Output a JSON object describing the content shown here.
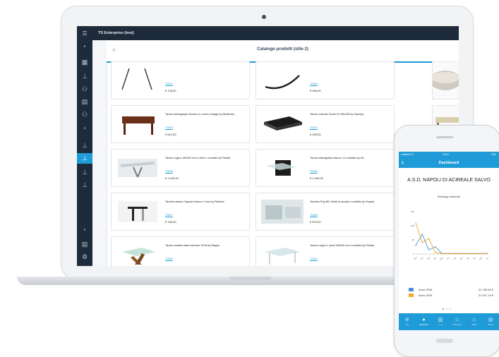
{
  "laptop": {
    "app_title": "TS Enterprise (test)",
    "page_title": "Catalogo prodotti (stile 2)",
    "products": [
      {
        "name": "",
        "link": "T0001",
        "price": "€ 178,00"
      },
      {
        "name": "",
        "link": "T0002",
        "price": "€ 265,00"
      },
      {
        "name": "Tavolo rettangolare Moreno in rovere vintage by Miniforms",
        "link": "T0003",
        "price": "€ 612,00"
      },
      {
        "name": "Tavolo cromato Teorie Ex 95x165 by Samoby",
        "link": "T0004",
        "price": "€ 289,00"
      },
      {
        "name": "Tavolo Logico 180x90 cm in vetro e cromato by Pedrali",
        "link": "T0005",
        "price": "€ 1.015,00"
      },
      {
        "name": "Tavolo rettangolare bianco 4 in cristallo by Nu",
        "link": "T0006",
        "price": "€ 1.400,00"
      },
      {
        "name": "Tavolino basso Capsule bianco e nero by Roberto",
        "link": "T0007",
        "price": "€ 196,00"
      },
      {
        "name": "Tavolino Pay Bit Cristal in acciaio e cristallo by Doppia",
        "link": "T0008",
        "price": "€ 670,00"
      },
      {
        "name": "Tavolo cristallo base marrone 30YA by Magris",
        "link": "T0009",
        "price": ""
      },
      {
        "name": "Tavolo Logico 2 piedi 180x90 cm in cristallo by Pedrali",
        "link": "T0010",
        "price": ""
      }
    ],
    "icons": {
      "menu": "menu-icon",
      "back": "back-arrow-icon"
    }
  },
  "phone": {
    "status_left": "vodafone IT",
    "status_time": "10:15",
    "status_right": "44%",
    "header_title": "Dashboard",
    "organization": "A.S.D. NAPOLI DI ACIREALE SALVO",
    "chart_title": "Riepilogo fatturato",
    "legend": [
      {
        "label": "Anno 2018",
        "value": "41.750,00 €",
        "color": "#4a90d9"
      },
      {
        "label": "Anno 2016",
        "value": "27.407,74 €",
        "color": "#f5a623"
      }
    ],
    "tabs": [
      {
        "label": "Info",
        "icon": "info-icon"
      },
      {
        "label": "Dashboard",
        "icon": "dashboard-icon"
      },
      {
        "label": "K - V",
        "icon": "bar-chart-icon"
      },
      {
        "label": "Documenti",
        "icon": "tag-icon"
      },
      {
        "label": "Ordini",
        "icon": "tag-icon"
      },
      {
        "label": "Fatture",
        "icon": "invoice-icon"
      }
    ]
  },
  "chart_data": {
    "type": "line",
    "title": "Riepilogo fatturato",
    "x": [
      "Gen",
      "Feb",
      "Mar",
      "Apr",
      "Mag",
      "Giu",
      "Lug",
      "Ago",
      "Set",
      "Ott",
      "Nov",
      "Dic"
    ],
    "series": [
      {
        "name": "Anno 2018",
        "values": [
          30,
          70,
          15,
          25,
          2,
          2,
          2,
          2,
          2,
          2,
          2,
          2
        ]
      },
      {
        "name": "Anno 2016",
        "values": [
          110,
          40,
          55,
          5,
          1,
          1,
          1,
          1,
          1,
          1,
          1,
          1
        ]
      }
    ],
    "ylim": [
      0,
      150
    ],
    "yticks": [
      0,
      50,
      100,
      150
    ],
    "colors": [
      "#4a90d9",
      "#f5a623"
    ]
  }
}
